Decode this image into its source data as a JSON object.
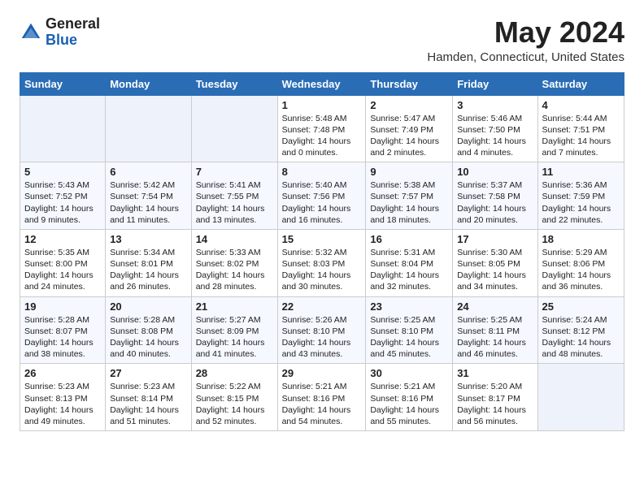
{
  "header": {
    "logo_general": "General",
    "logo_blue": "Blue",
    "month": "May 2024",
    "location": "Hamden, Connecticut, United States"
  },
  "weekdays": [
    "Sunday",
    "Monday",
    "Tuesday",
    "Wednesday",
    "Thursday",
    "Friday",
    "Saturday"
  ],
  "weeks": [
    [
      {
        "day": "",
        "info": ""
      },
      {
        "day": "",
        "info": ""
      },
      {
        "day": "",
        "info": ""
      },
      {
        "day": "1",
        "info": "Sunrise: 5:48 AM\nSunset: 7:48 PM\nDaylight: 14 hours\nand 0 minutes."
      },
      {
        "day": "2",
        "info": "Sunrise: 5:47 AM\nSunset: 7:49 PM\nDaylight: 14 hours\nand 2 minutes."
      },
      {
        "day": "3",
        "info": "Sunrise: 5:46 AM\nSunset: 7:50 PM\nDaylight: 14 hours\nand 4 minutes."
      },
      {
        "day": "4",
        "info": "Sunrise: 5:44 AM\nSunset: 7:51 PM\nDaylight: 14 hours\nand 7 minutes."
      }
    ],
    [
      {
        "day": "5",
        "info": "Sunrise: 5:43 AM\nSunset: 7:52 PM\nDaylight: 14 hours\nand 9 minutes."
      },
      {
        "day": "6",
        "info": "Sunrise: 5:42 AM\nSunset: 7:54 PM\nDaylight: 14 hours\nand 11 minutes."
      },
      {
        "day": "7",
        "info": "Sunrise: 5:41 AM\nSunset: 7:55 PM\nDaylight: 14 hours\nand 13 minutes."
      },
      {
        "day": "8",
        "info": "Sunrise: 5:40 AM\nSunset: 7:56 PM\nDaylight: 14 hours\nand 16 minutes."
      },
      {
        "day": "9",
        "info": "Sunrise: 5:38 AM\nSunset: 7:57 PM\nDaylight: 14 hours\nand 18 minutes."
      },
      {
        "day": "10",
        "info": "Sunrise: 5:37 AM\nSunset: 7:58 PM\nDaylight: 14 hours\nand 20 minutes."
      },
      {
        "day": "11",
        "info": "Sunrise: 5:36 AM\nSunset: 7:59 PM\nDaylight: 14 hours\nand 22 minutes."
      }
    ],
    [
      {
        "day": "12",
        "info": "Sunrise: 5:35 AM\nSunset: 8:00 PM\nDaylight: 14 hours\nand 24 minutes."
      },
      {
        "day": "13",
        "info": "Sunrise: 5:34 AM\nSunset: 8:01 PM\nDaylight: 14 hours\nand 26 minutes."
      },
      {
        "day": "14",
        "info": "Sunrise: 5:33 AM\nSunset: 8:02 PM\nDaylight: 14 hours\nand 28 minutes."
      },
      {
        "day": "15",
        "info": "Sunrise: 5:32 AM\nSunset: 8:03 PM\nDaylight: 14 hours\nand 30 minutes."
      },
      {
        "day": "16",
        "info": "Sunrise: 5:31 AM\nSunset: 8:04 PM\nDaylight: 14 hours\nand 32 minutes."
      },
      {
        "day": "17",
        "info": "Sunrise: 5:30 AM\nSunset: 8:05 PM\nDaylight: 14 hours\nand 34 minutes."
      },
      {
        "day": "18",
        "info": "Sunrise: 5:29 AM\nSunset: 8:06 PM\nDaylight: 14 hours\nand 36 minutes."
      }
    ],
    [
      {
        "day": "19",
        "info": "Sunrise: 5:28 AM\nSunset: 8:07 PM\nDaylight: 14 hours\nand 38 minutes."
      },
      {
        "day": "20",
        "info": "Sunrise: 5:28 AM\nSunset: 8:08 PM\nDaylight: 14 hours\nand 40 minutes."
      },
      {
        "day": "21",
        "info": "Sunrise: 5:27 AM\nSunset: 8:09 PM\nDaylight: 14 hours\nand 41 minutes."
      },
      {
        "day": "22",
        "info": "Sunrise: 5:26 AM\nSunset: 8:10 PM\nDaylight: 14 hours\nand 43 minutes."
      },
      {
        "day": "23",
        "info": "Sunrise: 5:25 AM\nSunset: 8:10 PM\nDaylight: 14 hours\nand 45 minutes."
      },
      {
        "day": "24",
        "info": "Sunrise: 5:25 AM\nSunset: 8:11 PM\nDaylight: 14 hours\nand 46 minutes."
      },
      {
        "day": "25",
        "info": "Sunrise: 5:24 AM\nSunset: 8:12 PM\nDaylight: 14 hours\nand 48 minutes."
      }
    ],
    [
      {
        "day": "26",
        "info": "Sunrise: 5:23 AM\nSunset: 8:13 PM\nDaylight: 14 hours\nand 49 minutes."
      },
      {
        "day": "27",
        "info": "Sunrise: 5:23 AM\nSunset: 8:14 PM\nDaylight: 14 hours\nand 51 minutes."
      },
      {
        "day": "28",
        "info": "Sunrise: 5:22 AM\nSunset: 8:15 PM\nDaylight: 14 hours\nand 52 minutes."
      },
      {
        "day": "29",
        "info": "Sunrise: 5:21 AM\nSunset: 8:16 PM\nDaylight: 14 hours\nand 54 minutes."
      },
      {
        "day": "30",
        "info": "Sunrise: 5:21 AM\nSunset: 8:16 PM\nDaylight: 14 hours\nand 55 minutes."
      },
      {
        "day": "31",
        "info": "Sunrise: 5:20 AM\nSunset: 8:17 PM\nDaylight: 14 hours\nand 56 minutes."
      },
      {
        "day": "",
        "info": ""
      }
    ]
  ]
}
